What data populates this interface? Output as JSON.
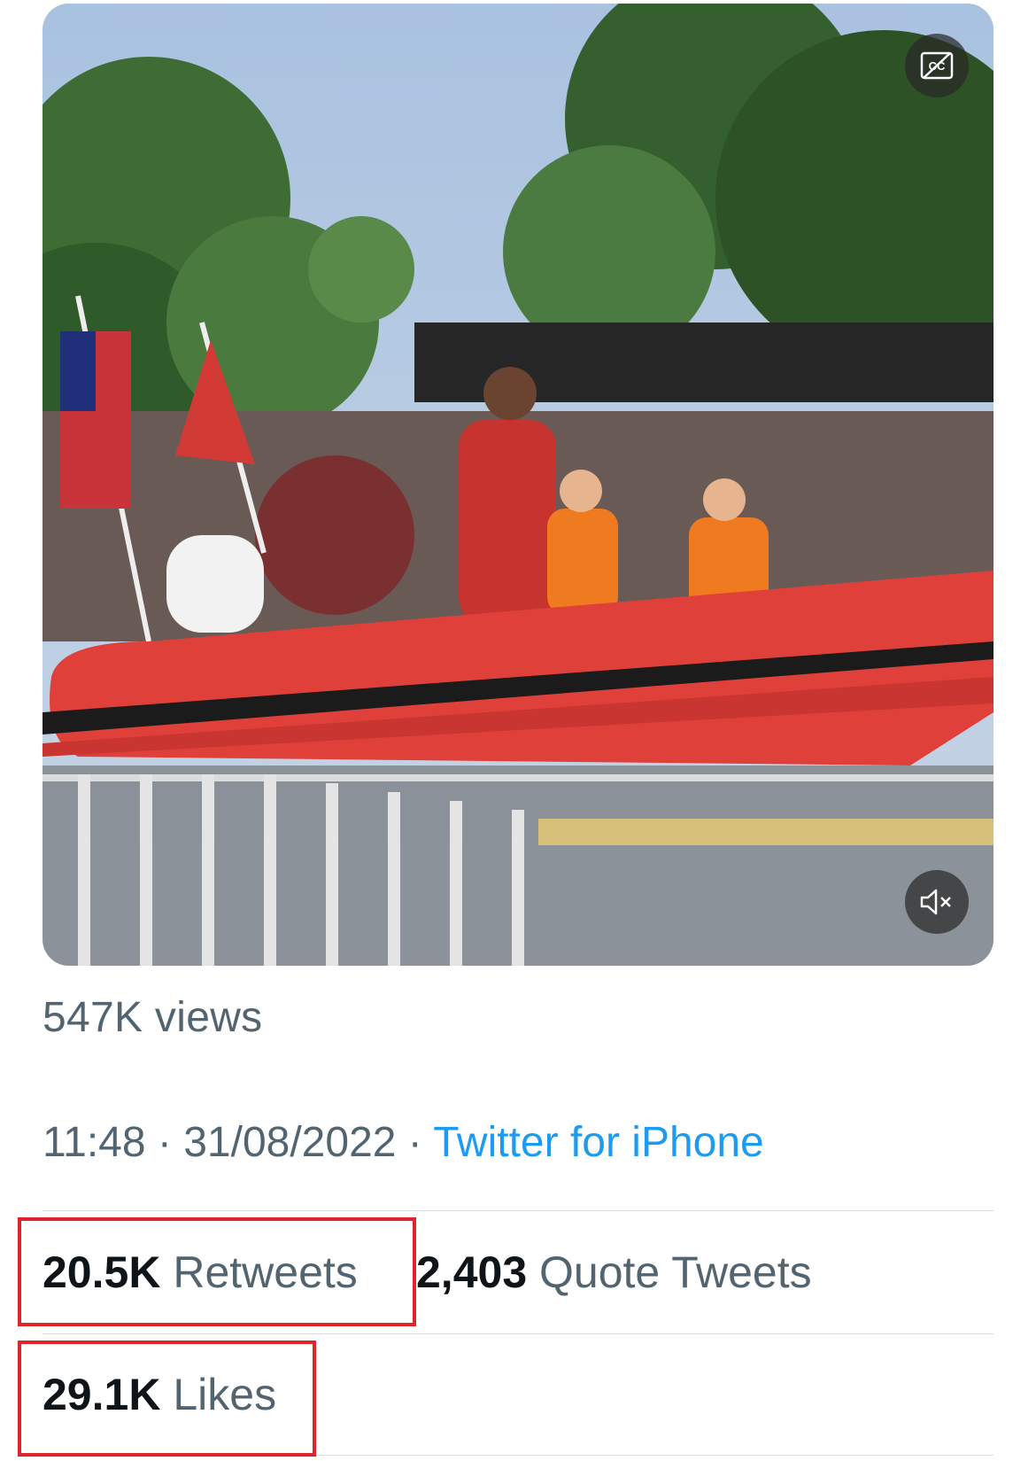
{
  "media": {
    "cc_icon": "closed-captions-icon",
    "mute_icon": "volume-muted-icon"
  },
  "tweet": {
    "views": "547K views",
    "time": "11:48",
    "sep1": " · ",
    "date": "31/08/2022",
    "sep2": " · ",
    "source": "Twitter for iPhone"
  },
  "stats": {
    "retweets_count": "20.5K",
    "retweets_label": "Retweets",
    "quotes_count": "2,403",
    "quotes_label": "Quote Tweets",
    "likes_count": "29.1K",
    "likes_label": "Likes"
  },
  "colors": {
    "highlight": "#e0242b",
    "link": "#1d9bf0",
    "muted_text": "#536471"
  }
}
